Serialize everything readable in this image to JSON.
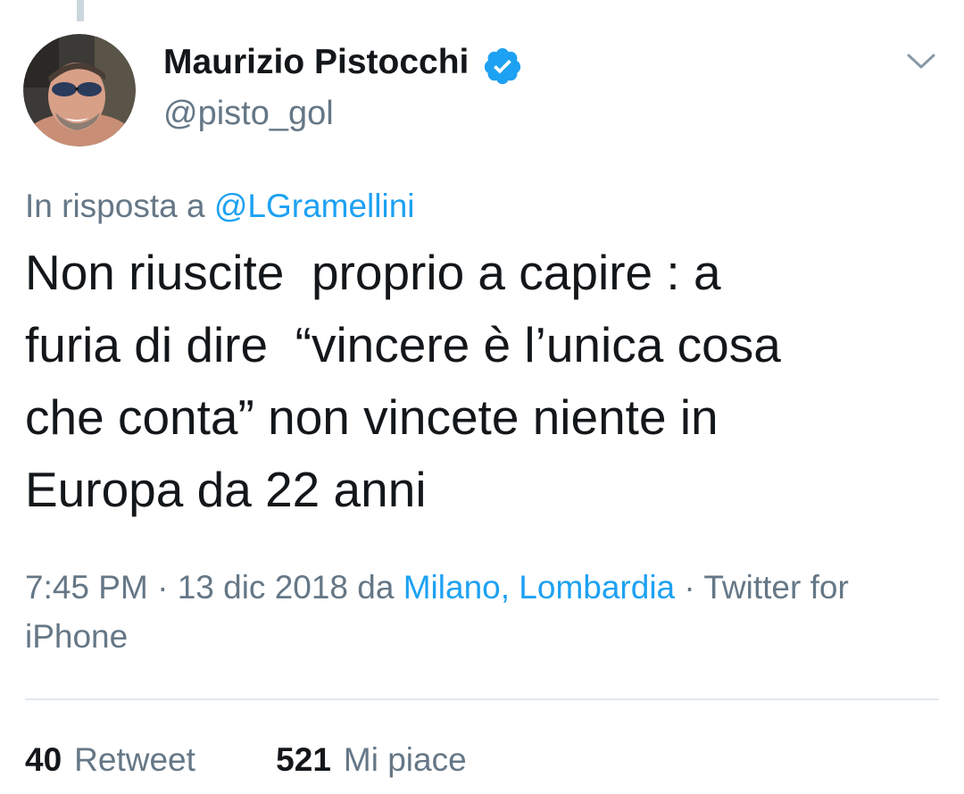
{
  "tweet": {
    "author": {
      "name": "Maurizio Pistocchi",
      "handle": "@pisto_gol",
      "verified": true,
      "avatar_icon": "avatar-photo"
    },
    "reply_to": {
      "prefix": "In risposta a",
      "mention": "@LGramellini"
    },
    "text": "Non riuscite  proprio a capire : a\nfuria di dire  “vincere è l’unica cosa\nche conta” non vincete niente in\nEuropa da 22 anni",
    "meta": {
      "time": "7:45 PM",
      "date": "13 dic 2018",
      "location_prefix": "da",
      "location": "Milano, Lombardia",
      "source": "Twitter for iPhone"
    },
    "stats": {
      "retweets_count": "40",
      "retweets_label": "Retweet",
      "likes_count": "521",
      "likes_label": "Mi piace"
    }
  },
  "colors": {
    "accent": "#1da1f2",
    "text": "#14171a",
    "secondary": "#657786",
    "divider": "#e1e8ed",
    "thread_line": "#ccd6dd"
  }
}
